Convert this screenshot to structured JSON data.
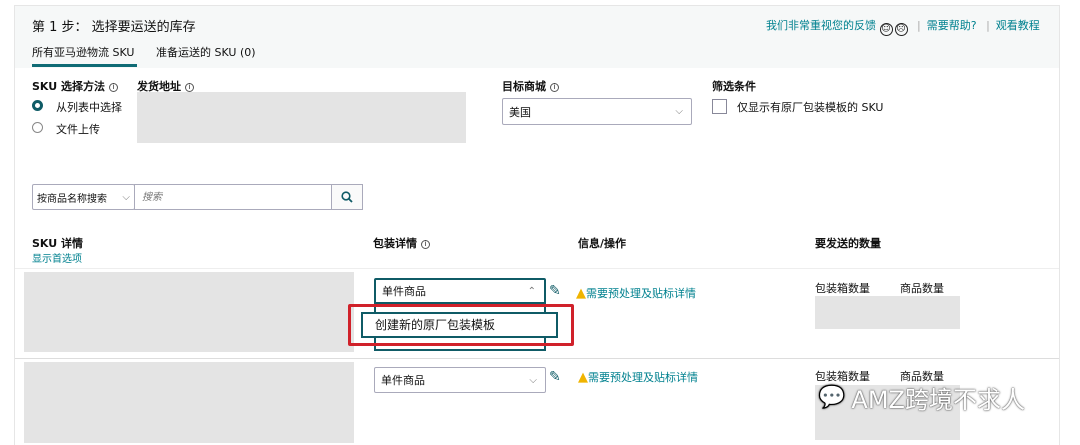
{
  "header": {
    "title": "第 1 步： 选择要运送的库存",
    "feedback": "我们非常重视您的反馈",
    "help": "需要帮助?",
    "tutorial": "观看教程",
    "sep": "|",
    "tabs": [
      {
        "label": "所有亚马逊物流 SKU"
      },
      {
        "label": "准备运送的 SKU (0)"
      }
    ]
  },
  "form": {
    "sku_method_label": "SKU 选择方法",
    "radio_list": "从列表中选择",
    "radio_upload": "文件上传",
    "ship_from_label": "发货地址",
    "marketplace_label": "目标商城",
    "marketplace_value": "美国",
    "filter_label": "筛选条件",
    "filter_checkbox": "仅显示有原厂包装模板的 SKU"
  },
  "search": {
    "type_value": "按商品名称搜索",
    "placeholder": "搜索"
  },
  "table": {
    "col_sku": "SKU 详情",
    "show_prefs": "显示首选项",
    "col_pack": "包装详情",
    "col_info": "信息/操作",
    "col_qty": "要发送的数量",
    "rows": [
      {
        "pack_value": "单件商品",
        "info_link": "需要预处理及贴标详情",
        "box_qty_label": "包装箱数量",
        "unit_qty_label": "商品数量"
      },
      {
        "pack_value": "单件商品",
        "info_link": "需要预处理及贴标详情",
        "box_qty_label": "包装箱数量",
        "unit_qty_label": "商品数量"
      }
    ],
    "dropdown_option": "创建新的原厂包装模板"
  },
  "watermark": "AMZ跨境不求人",
  "colors": {
    "accent": "#00818f",
    "highlight": "#d0212a"
  }
}
